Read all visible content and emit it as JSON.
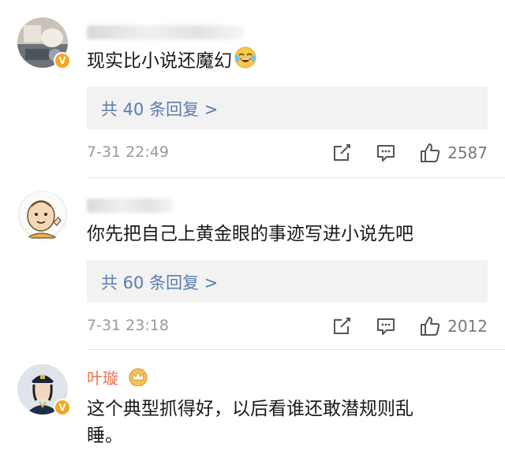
{
  "comments": [
    {
      "username": "",
      "text": "现实比小说还魔幻",
      "emoji": "laughing-tears",
      "replies_label": "共 40 条回复 >",
      "time": "7-31 22:49",
      "likes": "2587",
      "verified": true
    },
    {
      "username": "",
      "text": "你先把自己上黄金眼的事迹写进小说先吧",
      "replies_label": "共 60 条回复 >",
      "time": "7-31 23:18",
      "likes": "2012",
      "verified": false
    },
    {
      "username": "叶璇",
      "text_line1": "这个典型抓得好，以后看谁还敢潜规则乱",
      "text_line2": "睡。",
      "verified": true
    }
  ],
  "colors": {
    "username": "#eb7350",
    "reply_link": "#5a7db0",
    "verified_badge": "#f5a623",
    "meta": "#9a9a9a"
  },
  "icons": [
    "share-icon",
    "comment-icon",
    "like-icon",
    "verified-badge-icon",
    "laughing-emoji-icon",
    "crown-badge-icon"
  ]
}
